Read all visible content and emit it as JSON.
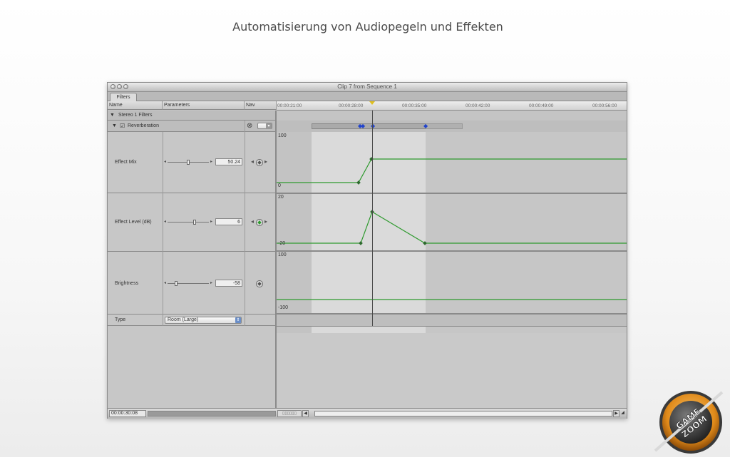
{
  "headline": "Automatisierung von Audiopegeln und Effekten",
  "window": {
    "title": "Clip 7 from Sequence 1",
    "tab": "Filters",
    "columns": {
      "name": "Name",
      "parameters": "Parameters",
      "nav": "Nav"
    },
    "ruler_ticks": [
      "00:00:21:00",
      "00:00:28:00",
      "00:00:35:00",
      "00:00:42:00",
      "00:00:49:00",
      "00:00:56:00"
    ],
    "group_row": "Stereo 1 Filters",
    "filter_row": {
      "label": "Reverberation",
      "checked": true
    },
    "parameters": [
      {
        "name": "Effect Mix",
        "value": "50.24",
        "graph_top": "100",
        "graph_bottom": "0",
        "slider_level_percent": 50
      },
      {
        "name": "Effect Level (dB)",
        "value": "6",
        "graph_top": "20",
        "graph_bottom": "-20",
        "slider_level_percent": 65
      },
      {
        "name": "Brightness",
        "value": "-58",
        "graph_top": "100",
        "graph_bottom": "-100",
        "slider_level_percent": 21
      }
    ],
    "type_row": {
      "name": "Type",
      "value": "Room (Large)"
    },
    "current_timecode": "00:00:30:08",
    "colors": {
      "keyframe_line": "#2e9a2e",
      "playhead": "#e0c020",
      "marker_blue": "#2244cc"
    }
  },
  "badge": {
    "text": "GAME ZOOM"
  }
}
